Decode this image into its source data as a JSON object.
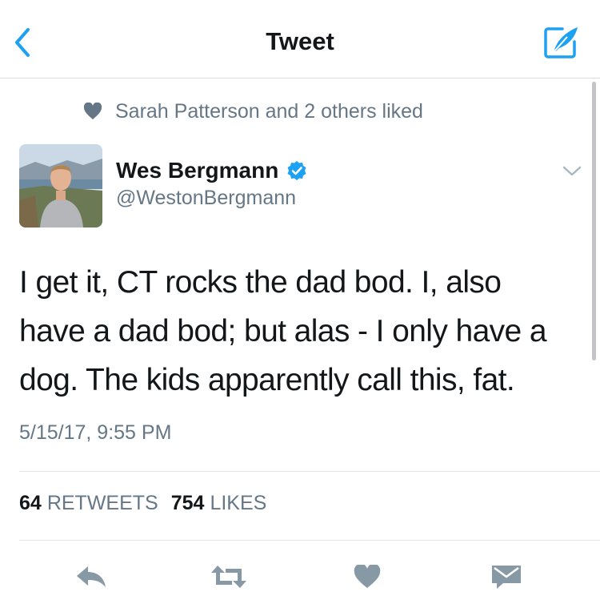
{
  "nav": {
    "title": "Tweet",
    "back_icon": "chevron-left-icon",
    "compose_icon": "compose-icon"
  },
  "colors": {
    "accent": "#1da1f2",
    "text_primary": "#14171a",
    "text_secondary": "#657786",
    "icon_gray": "#8899a6",
    "divider": "#e1e8ed"
  },
  "social_context": {
    "icon": "heart-icon",
    "text": "Sarah Patterson and 2 others liked"
  },
  "tweet": {
    "author_name": "Wes Bergmann",
    "author_handle": "@WestonBergmann",
    "verified": true,
    "text_lines": [
      "I get it, CT rocks the dad bod. I, also",
      "have a dad bod; but alas - I only have a",
      "dog. The kids apparently call this, fat."
    ],
    "timestamp": "5/15/17, 9:55 PM"
  },
  "stats": {
    "retweets_count": "64",
    "retweets_label": "RETWEETS",
    "likes_count": "754",
    "likes_label": "LIKES"
  },
  "actions": [
    {
      "name": "reply-icon"
    },
    {
      "name": "retweet-icon"
    },
    {
      "name": "like-heart-icon"
    },
    {
      "name": "direct-message-icon"
    }
  ]
}
